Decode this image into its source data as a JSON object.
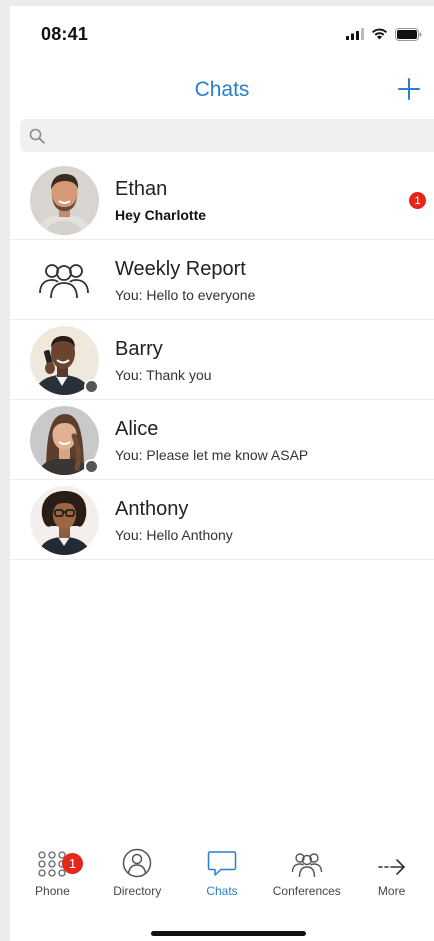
{
  "status_bar": {
    "time": "08:41"
  },
  "header": {
    "title": "Chats"
  },
  "search": {
    "value": "",
    "placeholder": ""
  },
  "chats": [
    {
      "name": "Ethan",
      "preview": "Hey Charlotte",
      "unread": "1"
    },
    {
      "name": "Weekly Report",
      "preview": "You: Hello to everyone"
    },
    {
      "name": "Barry",
      "preview": "You: Thank you"
    },
    {
      "name": "Alice",
      "preview": "You: Please let me know ASAP"
    },
    {
      "name": "Anthony",
      "preview": "You: Hello Anthony"
    }
  ],
  "tabs": [
    {
      "label": "Phone",
      "badge": "1"
    },
    {
      "label": "Directory"
    },
    {
      "label": "Chats",
      "active": true
    },
    {
      "label": "Conferences"
    },
    {
      "label": "More"
    }
  ],
  "colors": {
    "accent": "#2a7fca",
    "badge": "#e3271c",
    "presence": "#555555"
  },
  "icons": [
    "signal-icon",
    "wifi-icon",
    "battery-icon",
    "plus-icon",
    "search-icon",
    "group-icon",
    "keypad-icon",
    "person-icon",
    "chat-bubble-icon",
    "people-icon",
    "arrow-right-icon"
  ]
}
